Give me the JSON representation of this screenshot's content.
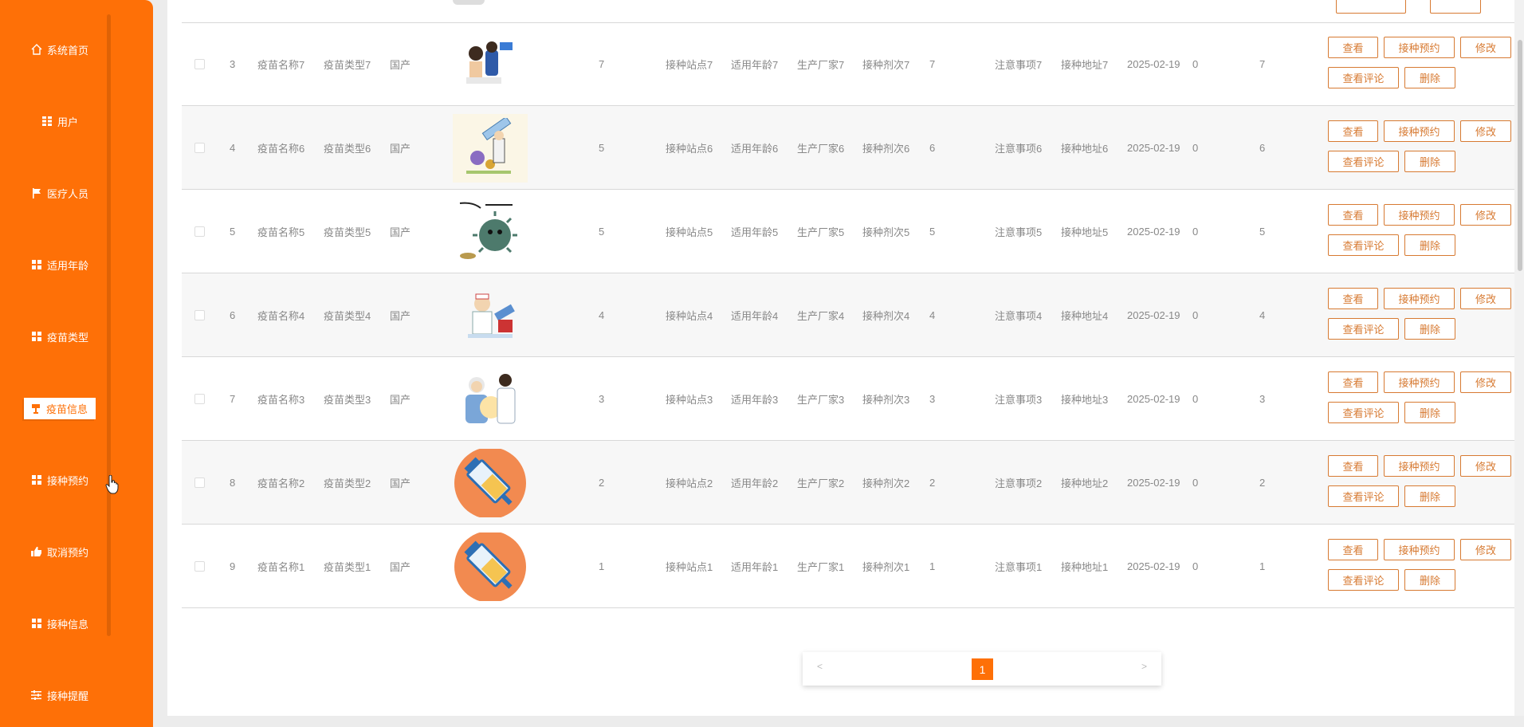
{
  "sidebar": {
    "items": [
      {
        "label": "系统首页",
        "icon": "home-icon"
      },
      {
        "label": "用户",
        "icon": "grid-icon"
      },
      {
        "label": "医疗人员",
        "icon": "flag-icon"
      },
      {
        "label": "适用年龄",
        "icon": "grid-icon"
      },
      {
        "label": "疫苗类型",
        "icon": "grid-icon"
      },
      {
        "label": "疫苗信息",
        "icon": "cup-icon",
        "active": true
      },
      {
        "label": "接种预约",
        "icon": "grid-icon"
      },
      {
        "label": "取消预约",
        "icon": "thumb-icon"
      },
      {
        "label": "接种信息",
        "icon": "grid-icon"
      },
      {
        "label": "接种提醒",
        "icon": "sliders-icon"
      }
    ]
  },
  "table": {
    "rows": [
      {
        "no": "3",
        "name": "疫苗名称7",
        "type": "疫苗类型7",
        "origin": "国产",
        "stock": "7",
        "site": "接种站点7",
        "age": "适用年龄7",
        "maker": "生产厂家7",
        "dose": "接种剂次7",
        "n": "7",
        "note": "注意事项7",
        "addr": "接种地址7",
        "date": "2025-02-19",
        "zero": "0",
        "count": "7"
      },
      {
        "no": "4",
        "name": "疫苗名称6",
        "type": "疫苗类型6",
        "origin": "国产",
        "stock": "5",
        "site": "接种站点6",
        "age": "适用年龄6",
        "maker": "生产厂家6",
        "dose": "接种剂次6",
        "n": "6",
        "note": "注意事项6",
        "addr": "接种地址6",
        "date": "2025-02-19",
        "zero": "0",
        "count": "6"
      },
      {
        "no": "5",
        "name": "疫苗名称5",
        "type": "疫苗类型5",
        "origin": "国产",
        "stock": "5",
        "site": "接种站点5",
        "age": "适用年龄5",
        "maker": "生产厂家5",
        "dose": "接种剂次5",
        "n": "5",
        "note": "注意事项5",
        "addr": "接种地址5",
        "date": "2025-02-19",
        "zero": "0",
        "count": "5"
      },
      {
        "no": "6",
        "name": "疫苗名称4",
        "type": "疫苗类型4",
        "origin": "国产",
        "stock": "4",
        "site": "接种站点4",
        "age": "适用年龄4",
        "maker": "生产厂家4",
        "dose": "接种剂次4",
        "n": "4",
        "note": "注意事项4",
        "addr": "接种地址4",
        "date": "2025-02-19",
        "zero": "0",
        "count": "4"
      },
      {
        "no": "7",
        "name": "疫苗名称3",
        "type": "疫苗类型3",
        "origin": "国产",
        "stock": "3",
        "site": "接种站点3",
        "age": "适用年龄3",
        "maker": "生产厂家3",
        "dose": "接种剂次3",
        "n": "3",
        "note": "注意事项3",
        "addr": "接种地址3",
        "date": "2025-02-19",
        "zero": "0",
        "count": "3"
      },
      {
        "no": "8",
        "name": "疫苗名称2",
        "type": "疫苗类型2",
        "origin": "国产",
        "stock": "2",
        "site": "接种站点2",
        "age": "适用年龄2",
        "maker": "生产厂家2",
        "dose": "接种剂次2",
        "n": "2",
        "note": "注意事项2",
        "addr": "接种地址2",
        "date": "2025-02-19",
        "zero": "0",
        "count": "2"
      },
      {
        "no": "9",
        "name": "疫苗名称1",
        "type": "疫苗类型1",
        "origin": "国产",
        "stock": "1",
        "site": "接种站点1",
        "age": "适用年龄1",
        "maker": "生产厂家1",
        "dose": "接种剂次1",
        "n": "1",
        "note": "注意事项1",
        "addr": "接种地址1",
        "date": "2025-02-19",
        "zero": "0",
        "count": "1"
      }
    ],
    "thumbs": [
      "doctor-patient-image",
      "syringe-virus-image",
      "virus-cartoon-image",
      "doctor-vaccine-image",
      "elderly-doctor-image",
      "syringe-circle-image",
      "syringe-circle-image"
    ]
  },
  "actions": {
    "view": "查看",
    "book": "接种预约",
    "edit": "修改",
    "reviews": "查看评论",
    "delete": "删除"
  },
  "pager": {
    "prev": "<",
    "next": ">",
    "current": "1"
  },
  "colors": {
    "accent": "#fe7007",
    "button_border": "#d77a32"
  }
}
